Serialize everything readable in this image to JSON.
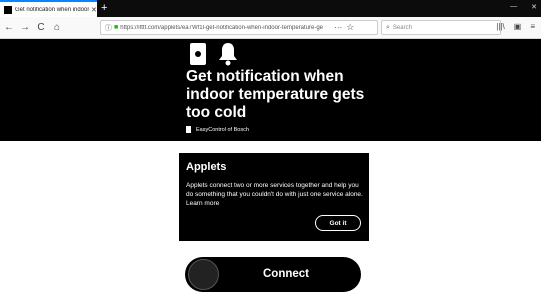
{
  "browser": {
    "tab_title": "Get notification when indoor te",
    "tab_close": "✕",
    "new_tab": "+",
    "window_controls": [
      "—",
      "✕"
    ],
    "nav": {
      "back": "←",
      "forward": "→",
      "reload": "C",
      "home": "⌂"
    },
    "url": "https://ifttt.com/applets/ea7Wf1l-get-notification-when-indoor-temperature-ge",
    "url_more": "···",
    "search_placeholder": "Search",
    "toolbar_right": [
      "|||\\",
      "▣",
      "≡"
    ]
  },
  "hero": {
    "title": "Get notification when indoor temperature gets too cold",
    "owner": "EasyControl of Bosch"
  },
  "applets_card": {
    "title": "Applets",
    "body": "Applets connect two or more services together and help you do something that you couldn't do with just one service alone. Learn more",
    "button": "Got it"
  },
  "connect": {
    "label": "Connect"
  }
}
